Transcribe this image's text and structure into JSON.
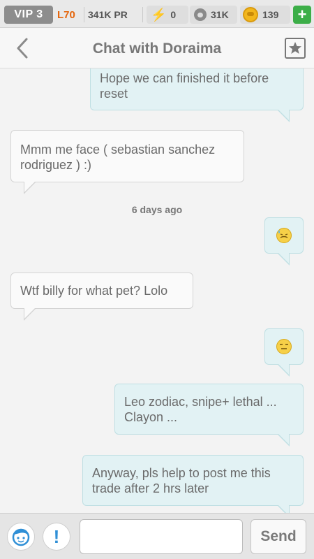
{
  "status": {
    "vip": "VIP 3",
    "level": "L70",
    "pr": "341K PR",
    "energy": "0",
    "paws": "31K",
    "coins": "139",
    "plus": "+"
  },
  "header": {
    "title": "Chat with Doraima"
  },
  "messages": [
    {
      "side": "out",
      "text": "Hope we can finished it before reset"
    },
    {
      "side": "in",
      "text": "Mmm me face ( sebastian sanchez rodriguez ) :)"
    },
    {
      "side": "out",
      "emoji": "sweat-smile-emoji"
    },
    {
      "side": "in",
      "text": "Wtf billy for what pet? Lolo"
    },
    {
      "side": "out",
      "emoji": "expressionless-emoji"
    },
    {
      "side": "out",
      "text": "Leo zodiac, snipe+ lethal ... Clayon ..."
    },
    {
      "side": "out",
      "text": "Anyway, pls help to post me this trade after 2 hrs later"
    }
  ],
  "timestamp": "6 days ago",
  "composer": {
    "placeholder": "",
    "value": "",
    "send_label": "Send"
  }
}
